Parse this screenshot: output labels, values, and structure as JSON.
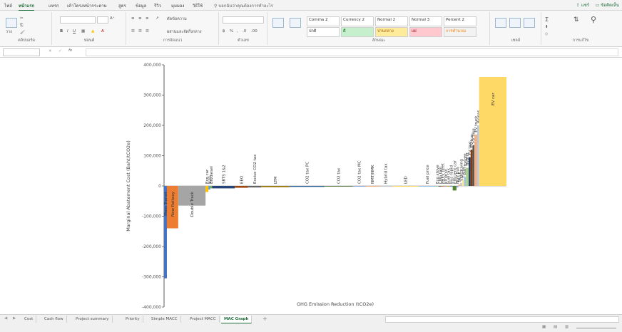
{
  "ribbon": {
    "tabs": [
      "ไฟล์",
      "หน้าแรก",
      "แทรก",
      "เค้าโครงหน้ากระดาษ",
      "สูตร",
      "ข้อมูล",
      "รีวิว",
      "มุมมอง",
      "วิธีใช้"
    ],
    "active_tab": 1,
    "tell_me": "บอกฉันว่าคุณต้องการทำอะไร",
    "share": "แชร์",
    "comments": "ข้อคิดเห็น",
    "groups": [
      "คลิปบอร์ด",
      "ฟอนต์",
      "การจัดแนว",
      "ตัวเลข",
      "ลักษณะ",
      "เซลล์",
      "การแก้ไข"
    ],
    "styles": [
      "Comma 2",
      "Currency 2",
      "Normal 2",
      "Normal 3",
      "Percent 2",
      "ปกติ",
      "ดี",
      "ปานกลาง",
      "แย่",
      "การคำนวณ"
    ],
    "paste_label": "วาง",
    "wrap_text": "ตัดข้อความ",
    "merge_center": "ผสานและจัดกึ่งกลาง"
  },
  "formula_bar": {
    "name_box": "",
    "fx": "fx",
    "value": ""
  },
  "sheet_tabs": [
    "Cost",
    "Cash flow",
    "Project summary",
    "Priority",
    "Simple MACC",
    "Project MACC",
    "MAC Graph"
  ],
  "active_sheet": 6,
  "add_sheet_glyph": "+",
  "colors": {
    "accent": "#1e6e3a",
    "blue": "#4472c4",
    "orange": "#ed7d31",
    "gray": "#a5a5a5",
    "yellow": "#ffc000",
    "gold": "#ffd966"
  },
  "chart_data": {
    "type": "bar",
    "subtype": "marginal-abatement-cost-curve",
    "ylabel": "Marginal Abatement Cost (Baht/tCO2e)",
    "xlabel": "GHG Emission Reduction (tCO2e)",
    "ylim": [
      -400000,
      400000
    ],
    "yticks": [
      -400000,
      -300000,
      -200000,
      -100000,
      0,
      100000,
      200000,
      300000,
      400000
    ],
    "ytick_labels": [
      "-400,000",
      "-300,000",
      "-200,000",
      "-100,000",
      "0",
      "100,000",
      "200,000",
      "300,000",
      "400,000"
    ],
    "grid": false,
    "legend": "none",
    "measures": [
      {
        "name": "Mass Transit",
        "width": 3,
        "value": -305000,
        "color": "#4472c4"
      },
      {
        "name": "New Railway",
        "width": 12,
        "value": -140000,
        "color": "#ed7d31"
      },
      {
        "name": "Double Track",
        "width": 29,
        "value": -65000,
        "color": "#a5a5a5"
      },
      {
        "name": "Eco car",
        "width": 3,
        "value": -20000,
        "color": "#ffc000"
      },
      {
        "name": "B20",
        "width": 2,
        "value": -12000,
        "color": "#5b9bd5"
      },
      {
        "name": "Biodiesel",
        "width": 2,
        "value": -8000,
        "color": "#70ad47"
      },
      {
        "name": "SRTS 1&2",
        "width": 24,
        "value": -8000,
        "color": "#264478"
      },
      {
        "name": "EEO",
        "width": 14,
        "value": -6000,
        "color": "#9e480e"
      },
      {
        "name": "Excise CO2 tax",
        "width": 14,
        "value": -5000,
        "color": "#636363"
      },
      {
        "name": "LTM",
        "width": 30,
        "value": -4000,
        "color": "#997300"
      },
      {
        "name": "CO2 tax PC",
        "width": 37,
        "value": -3000,
        "color": "#255e91"
      },
      {
        "name": "CO2 tax",
        "width": 30,
        "value": -2000,
        "color": "#43682b"
      },
      {
        "name": "CO2 tax MC",
        "width": 14,
        "value": -1500,
        "color": "#698ed0"
      },
      {
        "name": "NMT/NMK",
        "width": 14,
        "value": -1200,
        "color": "#f1975a"
      },
      {
        "name": "Hybrid tax",
        "width": 14,
        "value": -1000,
        "color": "#b7b7b7"
      },
      {
        "name": "LED",
        "width": 28,
        "value": -800,
        "color": "#ffcd33"
      },
      {
        "name": "Fuel price",
        "width": 18,
        "value": -700,
        "color": "#7cafdd"
      },
      {
        "name": "Eco stove",
        "width": 3,
        "value": -600,
        "color": "#8cc168"
      },
      {
        "name": "CNG taxi",
        "width": 3,
        "value": -500,
        "color": "#333f50"
      },
      {
        "name": "PHEV fleet",
        "width": 3,
        "value": -400,
        "color": "#c55a11"
      },
      {
        "name": "Ethanol",
        "width": 3,
        "value": -300,
        "color": "#7f7f7f"
      },
      {
        "name": "Fuel tax",
        "width": 3,
        "value": -200,
        "color": "#bf9000"
      },
      {
        "name": "Bus rapid",
        "width": 3,
        "value": -100,
        "color": "#2e75b6"
      },
      {
        "name": "Efficient car",
        "width": 4,
        "value": -15000,
        "color": "#548235"
      },
      {
        "name": "NGV bus",
        "width": 2,
        "value": -5000,
        "color": "#8faadc"
      },
      {
        "name": "Truck",
        "width": 2,
        "value": 5000,
        "color": "#f4b183"
      },
      {
        "name": "Eco driving",
        "width": 2,
        "value": 10000,
        "color": "#c9c9c9"
      },
      {
        "name": "E-bus",
        "width": 2,
        "value": 20000,
        "color": "#ffe699"
      },
      {
        "name": "Rail freight",
        "width": 2,
        "value": 30000,
        "color": "#9dc3e6"
      },
      {
        "name": "Hybrid",
        "width": 3,
        "value": 60000,
        "color": "#a9d18e"
      },
      {
        "name": "EV taxi",
        "width": 2,
        "value": 95000,
        "color": "#203864"
      },
      {
        "name": "EV bus",
        "width": 2,
        "value": 120000,
        "color": "#843c0c"
      },
      {
        "name": "EV bike",
        "width": 2,
        "value": 135000,
        "color": "#595959"
      },
      {
        "name": "EV truck",
        "width": 3,
        "value": 170000,
        "color": "#f4b183"
      },
      {
        "name": "Biogas",
        "width": 2,
        "value": 200000,
        "color": "#b4c7e7"
      },
      {
        "name": "EV car",
        "width": 29,
        "value": 360000,
        "color": "#ffd966"
      }
    ]
  }
}
